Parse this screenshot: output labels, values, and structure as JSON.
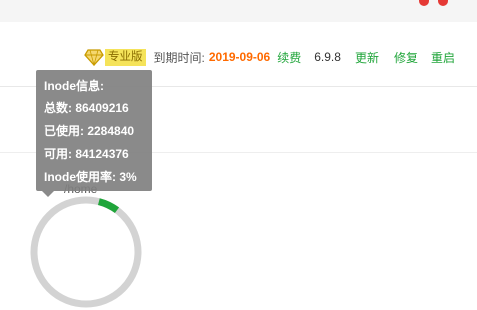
{
  "header": {
    "edition_badge": "专业版",
    "expire_label": "到期时间:",
    "expire_date": "2019-09-06",
    "renew_link": "续费",
    "version": "6.9.8",
    "update_link": "更新",
    "repair_link": "修复",
    "restart_link": "重启"
  },
  "tooltip": {
    "title": "Inode信息:",
    "total": "总数: 86409216",
    "used": "已使用: 2284840",
    "available": "可用: 84124376",
    "usage": "Inode使用率: 3%"
  },
  "disk": {
    "label": "/home",
    "inode_usage_fraction": 0.03
  },
  "colors": {
    "accent_green": "#20a53a",
    "expire_orange": "#ff6a00",
    "badge_yellow": "#f5e35a",
    "close_red": "#e53935"
  }
}
